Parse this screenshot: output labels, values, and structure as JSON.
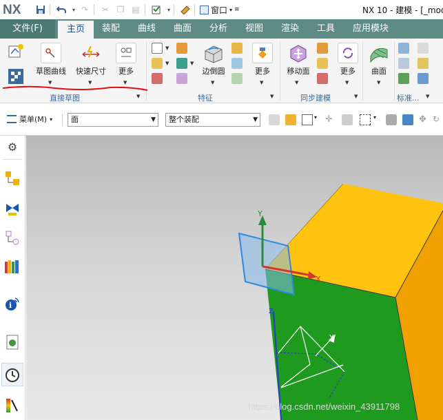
{
  "app": {
    "logo": "NX",
    "window_menu_label": "窗口",
    "title": "NX 10 - 建模 - [_mod"
  },
  "colors": {
    "tab_bar": "#5d8a82",
    "cube_top": "#ffc20e",
    "cube_front": "#1e9b1e",
    "cube_side": "#f0a000",
    "annotation_red": "#e01010",
    "csys_blue": "#2a78c8"
  },
  "tabs": [
    {
      "label": "文件(F)",
      "active": false
    },
    {
      "label": "主页",
      "active": true
    },
    {
      "label": "装配",
      "active": false
    },
    {
      "label": "曲线",
      "active": false
    },
    {
      "label": "曲面",
      "active": false
    },
    {
      "label": "分析",
      "active": false
    },
    {
      "label": "视图",
      "active": false
    },
    {
      "label": "渲染",
      "active": false
    },
    {
      "label": "工具",
      "active": false
    },
    {
      "label": "应用模块",
      "active": false
    }
  ],
  "ribbon": {
    "sketch_curve": "草图曲线",
    "rapid_dimension": "快速尺寸",
    "more1": "更多",
    "edge_blend": "边倒圆",
    "more2": "更多",
    "move_face": "移动面",
    "more3": "更多",
    "surface": "曲面",
    "groups": {
      "direct_sketch": "直接草图",
      "feature": "特征",
      "sync_modeling": "同步建模",
      "standard": "标准..."
    }
  },
  "toolbar": {
    "menu_label": "菜单(M)",
    "select_filter": "面",
    "select_scope": "整个装配"
  },
  "viewport": {
    "axis_labels": {
      "y": "Y",
      "x": "X",
      "z": "Z",
      "y2": "Y"
    },
    "watermark": "https://blog.csdn.net/weixin_43911798"
  }
}
